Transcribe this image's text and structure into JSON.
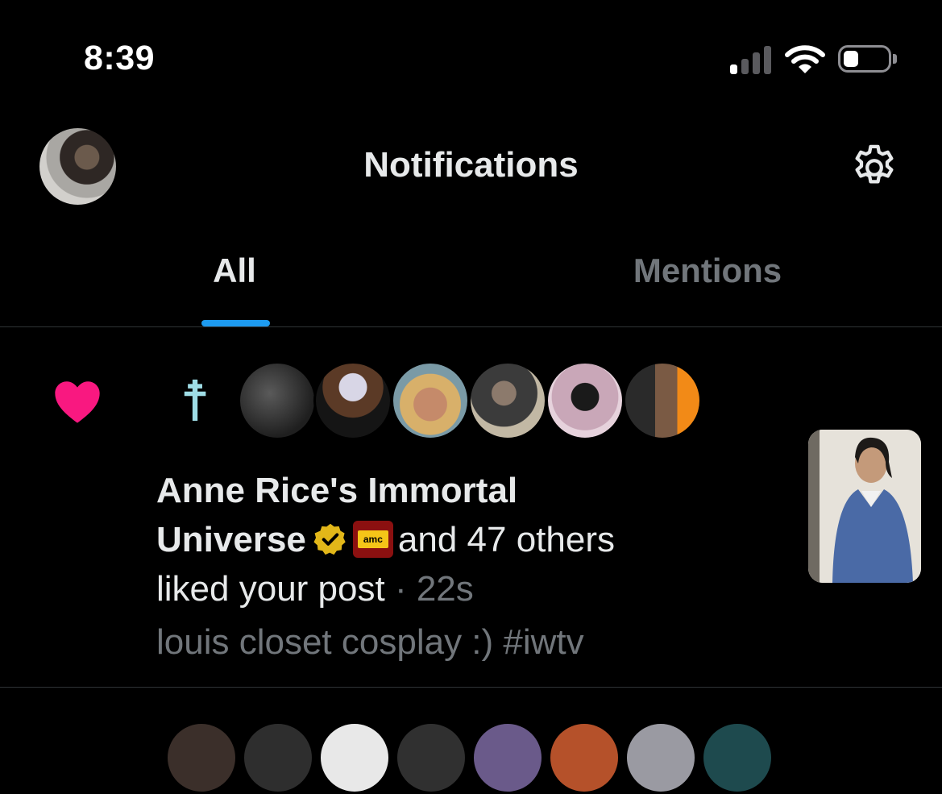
{
  "status_bar": {
    "time": "8:39",
    "signal_bars_active": 1,
    "battery_level": 0.25
  },
  "header": {
    "title": "Notifications",
    "avatar_icon": "user-avatar",
    "settings_icon": "gear-icon"
  },
  "tabs": [
    {
      "label": "All",
      "active": true
    },
    {
      "label": "Mentions",
      "active": false
    }
  ],
  "notification": {
    "type_icon": "heart-icon",
    "accent_color": "#f91880",
    "name": "Anne Rice's Immortal Universe",
    "name_line1": "Anne Rice's Immortal",
    "name_line2": "Universe",
    "badges": [
      "verified-gold-badge",
      "amc-affiliate-badge"
    ],
    "amc_label": "amc",
    "others": "and 47 others",
    "action": "liked your post",
    "separator": "·",
    "elapsed": "22s",
    "post_text": "louis closet cosplay :) #iwtv",
    "liker_count_shown": 7
  },
  "colors": {
    "background": "#000000",
    "primary_text": "#e7e9ea",
    "secondary_text": "#71767b",
    "tab_indicator": "#1d9bf0",
    "divider": "#2f3336"
  }
}
